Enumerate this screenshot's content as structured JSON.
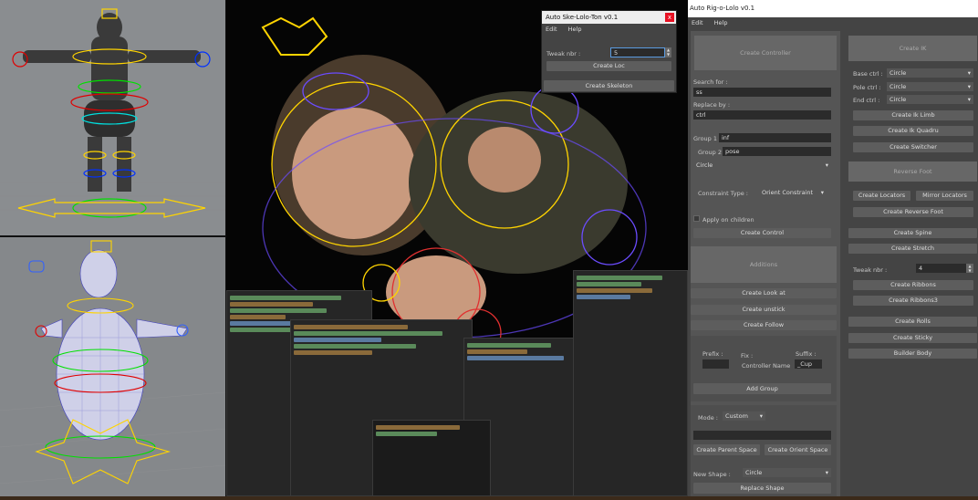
{
  "ske_window": {
    "title": "Auto Ske-Lolo-Ton v0.1",
    "close": "x",
    "menu": [
      "Edit",
      "Help"
    ],
    "tweak_label": "Tweak nbr :",
    "tweak_value": "5",
    "create_loc": "Create Loc",
    "create_skeleton": "Create Skeleton"
  },
  "rig_window": {
    "title": "Auto Rig-o-Lolo v0.1",
    "menu": [
      "Edit",
      "Help"
    ],
    "create_controller": "Create Controller",
    "search_label": "Search for :",
    "search_value": "ss",
    "replace_label": "Replace by :",
    "replace_value": "ctrl",
    "group1_label": "Group 1 :",
    "group1_value": "inf",
    "group2_label": "Group 2 :",
    "group2_value": "pose",
    "shape_value": "Circle",
    "constraint_label": "Constraint Type :",
    "constraint_value": "Orient Constraint",
    "apply_children": "Apply on children",
    "create_control": "Create Control",
    "additions": "Additions",
    "create_look_at": "Create Look at",
    "create_unstick": "Create unstick",
    "create_follow": "Create Follow",
    "prefix_label": "Prefix :",
    "fix_label": "Fix :",
    "suffix_label": "Suffix :",
    "controller_name": "Controller Name",
    "suffix_value": "_Cup",
    "add_group": "Add Group",
    "mode_label": "Mode :",
    "mode_value": "Custom",
    "create_parent_space": "Create Parent Space",
    "create_orient_space": "Create Orient Space",
    "new_shape_label": "New Shape :",
    "new_shape_value": "Circle",
    "replace_shape": "Replace Shape",
    "create_ik": "Create IK",
    "base_ctrl_label": "Base ctrl :",
    "base_ctrl_value": "Circle",
    "pole_ctrl_label": "Pole ctrl :",
    "pole_ctrl_value": "Circle",
    "end_ctrl_label": "End ctrl :",
    "end_ctrl_value": "Circle",
    "create_ik_limb": "Create Ik Limb",
    "create_ik_quadru": "Create Ik Quadru",
    "create_switcher": "Create Switcher",
    "reverse_foot": "Reverse Foot",
    "create_locators": "Create Locators",
    "mirror_locators": "Mirror Locators",
    "create_reverse_foot": "Create Reverse Foot",
    "create_spine": "Create Spine",
    "create_stretch": "Create Stretch",
    "tweak_label": "Tweak nbr :",
    "tweak_value": "4",
    "create_ribbons": "Create Ribbons",
    "create_ribbons3": "Create Ribbons3",
    "create_rolls": "Create Rolls",
    "create_sticky": "Create Sticky",
    "builder_body": "Builder Body"
  }
}
